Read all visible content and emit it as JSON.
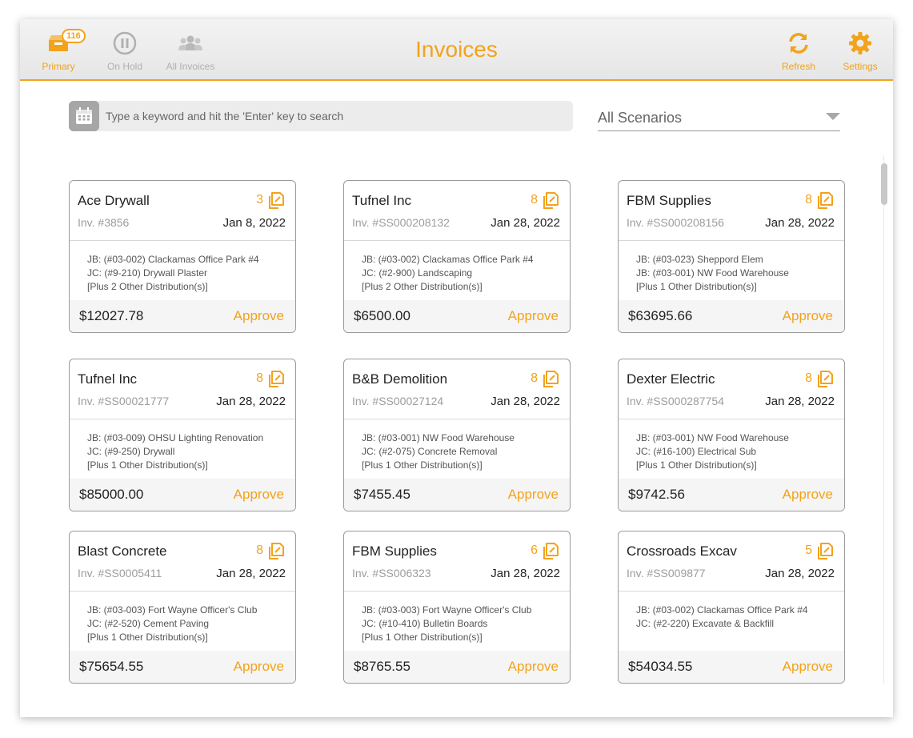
{
  "header": {
    "title": "Invoices",
    "nav": {
      "primary": {
        "label": "Primary",
        "badge": "116",
        "icon": "inbox-icon"
      },
      "on_hold": {
        "label": "On Hold",
        "icon": "pause-icon"
      },
      "all_invoices": {
        "label": "All Invoices",
        "icon": "people-icon"
      },
      "refresh": {
        "label": "Refresh",
        "icon": "refresh-icon"
      },
      "settings": {
        "label": "Settings",
        "icon": "gear-icon"
      }
    }
  },
  "search": {
    "placeholder": "Type a keyword and hit the 'Enter' key to search",
    "icon": "calendar-icon"
  },
  "scenario": {
    "selected": "All Scenarios"
  },
  "colors": {
    "accent": "#f2a31b",
    "muted": "#9c9c9c"
  },
  "approve_label": "Approve",
  "cards": [
    {
      "vendor": "Ace Drywall",
      "count": "3",
      "inv": "Inv. #3856",
      "date": "Jan 8, 2022",
      "lines": [
        "JB: (#03-002) Clackamas Office Park #4",
        "JC: (#9-210) Drywall Plaster",
        "[Plus 2 Other Distribution(s)]"
      ],
      "amount": "$12027.78"
    },
    {
      "vendor": "Tufnel Inc",
      "count": "8",
      "inv": "Inv. #SS000208132",
      "date": "Jan 28, 2022",
      "lines": [
        "JB: (#03-002) Clackamas Office Park #4",
        "JC: (#2-900) Landscaping",
        "[Plus 2 Other Distribution(s)]"
      ],
      "amount": "$6500.00"
    },
    {
      "vendor": "FBM Supplies",
      "count": "8",
      "inv": "Inv. #SS000208156",
      "date": "Jan 28, 2022",
      "lines": [
        "JB: (#03-023) Sheppord Elem",
        "JB: (#03-001) NW Food Warehouse",
        "[Plus 1 Other Distribution(s)]"
      ],
      "amount": "$63695.66"
    },
    {
      "vendor": "Tufnel Inc",
      "count": "8",
      "inv": "Inv. #SS00021777",
      "date": "Jan 28, 2022",
      "lines": [
        "JB: (#03-009) OHSU Lighting Renovation",
        "JC: (#9-250) Drywall",
        "[Plus 1 Other Distribution(s)]"
      ],
      "amount": "$85000.00"
    },
    {
      "vendor": "B&B Demolition",
      "count": "8",
      "inv": "Inv. #SS00027124",
      "date": "Jan 28, 2022",
      "lines": [
        "JB: (#03-001) NW Food Warehouse",
        "JC: (#2-075) Concrete Removal",
        "[Plus 1 Other Distribution(s)]"
      ],
      "amount": "$7455.45"
    },
    {
      "vendor": "Dexter Electric",
      "count": "8",
      "inv": "Inv. #SS000287754",
      "date": "Jan 28, 2022",
      "lines": [
        "JB: (#03-001) NW Food Warehouse",
        "JC: (#16-100) Electrical Sub",
        "[Plus 1 Other Distribution(s)]"
      ],
      "amount": "$9742.56"
    },
    {
      "vendor": "Blast Concrete",
      "count": "8",
      "inv": "Inv. #SS0005411",
      "date": "Jan 28, 2022",
      "lines": [
        "JB: (#03-003) Fort Wayne Officer's Club",
        "JC: (#2-520) Cement Paving",
        "[Plus 1 Other Distribution(s)]"
      ],
      "amount": "$75654.55"
    },
    {
      "vendor": "FBM Supplies",
      "count": "6",
      "inv": "Inv. #SS006323",
      "date": "Jan 28, 2022",
      "lines": [
        "JB: (#03-003) Fort Wayne Officer's Club",
        "JC: (#10-410) Bulletin Boards",
        "[Plus 1 Other Distribution(s)]"
      ],
      "amount": "$8765.55"
    },
    {
      "vendor": "Crossroads Excav",
      "count": "5",
      "inv": "Inv. #SS009877",
      "date": "Jan 28, 2022",
      "lines": [
        "JB: (#03-002) Clackamas Office Park #4",
        "JC: (#2-220) Excavate & Backfill"
      ],
      "amount": "$54034.55"
    }
  ]
}
